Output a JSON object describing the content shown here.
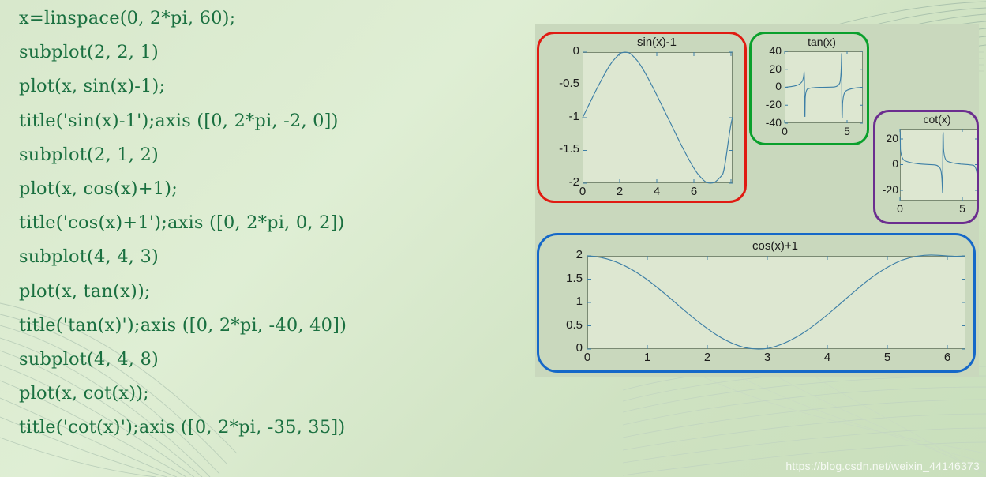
{
  "slide": {
    "background_color": "#d8e8cc",
    "code_text_color": "#1a7040",
    "figure_panel_color": "#c9d8bd"
  },
  "code": {
    "lines": [
      "x=linspace(0, 2*pi, 60);",
      "subplot(2, 2, 1)",
      "plot(x, sin(x)-1);",
      "title('sin(x)-1');axis ([0, 2*pi, -2, 0])",
      "subplot(2, 1, 2)",
      "plot(x, cos(x)+1);",
      "title('cos(x)+1');axis ([0, 2*pi, 0, 2])",
      "subplot(4, 4, 3)",
      "plot(x, tan(x));",
      "title('tan(x)');axis ([0, 2*pi, -40, 40])",
      "subplot(4, 4, 8)",
      "plot(x, cot(x));",
      "title('cot(x)');axis ([0, 2*pi, -35, 35])"
    ]
  },
  "figure": {
    "highlights": [
      {
        "name": "sin-highlight",
        "color": "#e01b12"
      },
      {
        "name": "tan-highlight",
        "color": "#0aa02c"
      },
      {
        "name": "cot-highlight",
        "color": "#6b2d8f"
      },
      {
        "name": "cos-highlight",
        "color": "#1568c8"
      }
    ]
  },
  "chart_data": [
    {
      "id": "sin",
      "type": "line",
      "title": "sin(x)-1",
      "xlabel": "",
      "ylabel": "",
      "xlim": [
        0,
        6.2832
      ],
      "ylim": [
        -2,
        0
      ],
      "xticks": [
        0,
        2,
        4,
        6
      ],
      "xticklabels": [
        "0",
        "2",
        "4",
        "6"
      ],
      "yticks": [
        0,
        -0.5,
        -1,
        -1.5,
        -2
      ],
      "yticklabels": [
        "0",
        "-0.5",
        "-1",
        "-1.5",
        "-2"
      ],
      "grid": false,
      "legend": "none",
      "series": [
        {
          "name": "sin(x)-1",
          "expression": "sin(x) - 1",
          "n_points": 60,
          "x": [
            0,
            0.3927,
            0.7854,
            1.1781,
            1.5708,
            1.9635,
            2.3562,
            2.7489,
            3.1416,
            3.5343,
            3.927,
            4.3197,
            4.7124,
            5.1051,
            5.4978,
            5.8905,
            6.2832
          ],
          "y": [
            -1,
            -0.6173,
            -0.2929,
            -0.0761,
            0,
            -0.0761,
            -0.2929,
            -0.6173,
            -1,
            -1.3827,
            -1.7071,
            -1.9239,
            -2,
            -1.9239,
            -1.7071,
            -1.3827,
            -1
          ]
        }
      ],
      "highlight_color": "#e01b12"
    },
    {
      "id": "tan",
      "type": "line",
      "title": "tan(x)",
      "xlabel": "",
      "ylabel": "",
      "xlim": [
        0,
        6.2832
      ],
      "ylim": [
        -40,
        40
      ],
      "xticks": [
        0,
        5
      ],
      "xticklabels": [
        "0",
        "5"
      ],
      "yticks": [
        40,
        20,
        0,
        -20,
        -40
      ],
      "yticklabels": [
        "40",
        "20",
        "0",
        "-20",
        "-40"
      ],
      "grid": false,
      "legend": "none",
      "series": [
        {
          "name": "tan(x)",
          "expression": "tan(x)",
          "n_points": 60,
          "asymptotes": [
            1.5708,
            4.7124
          ],
          "peak_values": [
            12,
            -37,
            38,
            -13
          ]
        }
      ],
      "highlight_color": "#0aa02c"
    },
    {
      "id": "cot",
      "type": "line",
      "title": "cot(x)",
      "xlabel": "",
      "ylabel": "",
      "xlim": [
        0,
        6.2832
      ],
      "ylim": [
        -35,
        35
      ],
      "xticks": [
        0,
        5
      ],
      "xticklabels": [
        "0",
        "5"
      ],
      "yticks": [
        20,
        0,
        -20
      ],
      "yticklabels": [
        "20",
        "0",
        "-20"
      ],
      "grid": false,
      "legend": "none",
      "series": [
        {
          "name": "cot(x)",
          "expression": "cot(x)",
          "n_points": 60,
          "asymptotes": [
            0,
            3.1416,
            6.2832
          ]
        }
      ],
      "highlight_color": "#6b2d8f"
    },
    {
      "id": "cos",
      "type": "line",
      "title": "cos(x)+1",
      "xlabel": "",
      "ylabel": "",
      "xlim": [
        0,
        6.2832
      ],
      "ylim": [
        0,
        2
      ],
      "xticks": [
        0,
        1,
        2,
        3,
        4,
        5,
        6
      ],
      "xticklabels": [
        "0",
        "1",
        "2",
        "3",
        "4",
        "5",
        "6"
      ],
      "yticks": [
        2,
        1.5,
        1,
        0.5,
        0
      ],
      "yticklabels": [
        "2",
        "1.5",
        "1",
        "0.5",
        "0"
      ],
      "grid": false,
      "legend": "none",
      "series": [
        {
          "name": "cos(x)+1",
          "expression": "cos(x) + 1",
          "n_points": 60,
          "x": [
            0,
            0.3927,
            0.7854,
            1.1781,
            1.5708,
            1.9635,
            2.3562,
            2.7489,
            3.1416,
            3.5343,
            3.927,
            4.3197,
            4.7124,
            5.1051,
            5.4978,
            5.8905,
            6.2832
          ],
          "y": [
            2,
            1.9239,
            1.7071,
            1.3827,
            1,
            0.6173,
            0.2929,
            0.0761,
            0,
            0.0761,
            0.2929,
            0.6173,
            1,
            1.3827,
            1.7071,
            1.9239,
            2
          ]
        }
      ],
      "highlight_color": "#1568c8"
    }
  ],
  "watermark": {
    "text": "https://blog.csdn.net/weixin_44146373"
  }
}
